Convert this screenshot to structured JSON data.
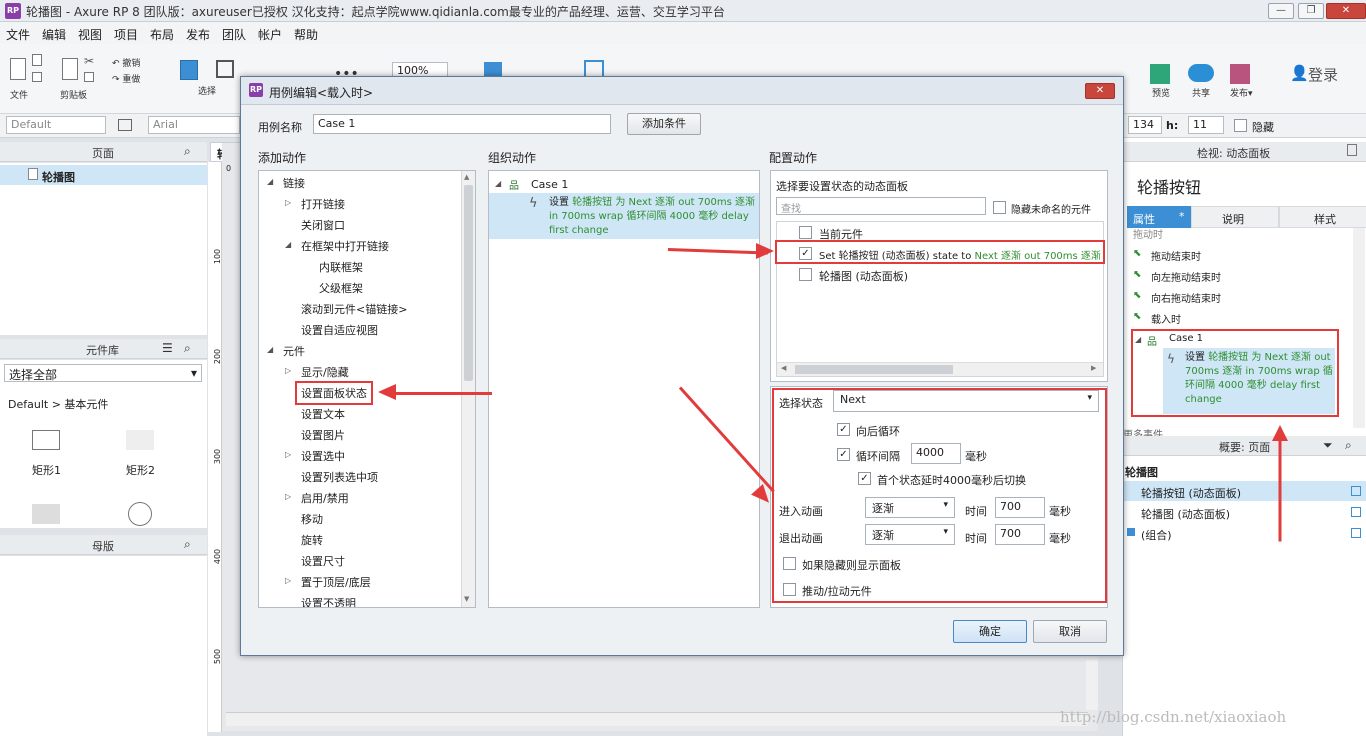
{
  "window": {
    "title": "轮播图 - Axure RP 8 团队版：axureuser已授权 汉化支持：起点学院www.qidianla.com最专业的产品经理、运营、交互学习平台",
    "app_icon": "RP",
    "minimize": "—",
    "restore": "❐",
    "close": "✕"
  },
  "menu": [
    "文件",
    "编辑",
    "视图",
    "项目",
    "布局",
    "发布",
    "团队",
    "帐户",
    "帮助"
  ],
  "toolbar": {
    "file_label": "文件",
    "clipboard_label": "剪贴板",
    "undo_label": "撤销",
    "redo_label": "重做",
    "select_label": "选择",
    "zoom": "100%",
    "preview_label": "预览",
    "share_label": "共享",
    "publish_label": "发布▾",
    "login_label": "登录",
    "style_select": "Default",
    "font_select": "Arial",
    "y_value": "134",
    "h_label": "h:",
    "h_value": "11",
    "hidden_label": "隐藏"
  },
  "pages_panel": {
    "title": "页面",
    "page_name": "轮播图"
  },
  "library_panel": {
    "title": "元件库",
    "select_all": "选择全部",
    "group": "Default > 基本元件",
    "items": [
      "矩形1",
      "矩形2"
    ]
  },
  "masters_panel": {
    "title": "母版"
  },
  "canvas": {
    "tab": "轮播",
    "ruler_top": "0",
    "ruler_left": [
      "100",
      "200",
      "300",
      "400",
      "500"
    ]
  },
  "inspector": {
    "header": "检视: 动态面板",
    "widget_name": "轮播按钮",
    "tabs": [
      "属性",
      "说明",
      "样式"
    ],
    "events": [
      "拖动时",
      "拖动结束时",
      "向左拖动结束时",
      "向右拖动结束时",
      "载入时"
    ],
    "case_name": "Case 1",
    "action_prefix": "设置 ",
    "action_text": "轮播按钮 为 Next 逐渐 out 700ms 逐渐 in 700ms wrap 循环间隔 4000 毫秒 delay first change",
    "more": "更多事件"
  },
  "outline": {
    "header": "概要: 页面",
    "root": "轮播图",
    "items": [
      "轮播按钮 (动态面板)",
      "轮播图 (动态面板)",
      "(组合)"
    ]
  },
  "dialog": {
    "title": "用例编辑<载入时>",
    "case_name_label": "用例名称",
    "case_name_value": "Case 1",
    "add_condition": "添加条件",
    "col1_title": "添加动作",
    "col2_title": "组织动作",
    "col3_title": "配置动作",
    "actions": [
      {
        "label": "链接",
        "level": 0,
        "tri": "◢"
      },
      {
        "label": "打开链接",
        "level": 1,
        "tri": "▷"
      },
      {
        "label": "关闭窗口",
        "level": 1,
        "tri": ""
      },
      {
        "label": "在框架中打开链接",
        "level": 1,
        "tri": "◢"
      },
      {
        "label": "内联框架",
        "level": 2,
        "tri": ""
      },
      {
        "label": "父级框架",
        "level": 2,
        "tri": ""
      },
      {
        "label": "滚动到元件<锚链接>",
        "level": 1,
        "tri": ""
      },
      {
        "label": "设置自适应视图",
        "level": 1,
        "tri": ""
      },
      {
        "label": "元件",
        "level": 0,
        "tri": "◢"
      },
      {
        "label": "显示/隐藏",
        "level": 1,
        "tri": "▷"
      },
      {
        "label": "设置面板状态",
        "level": 1,
        "tri": ""
      },
      {
        "label": "设置文本",
        "level": 1,
        "tri": ""
      },
      {
        "label": "设置图片",
        "level": 1,
        "tri": ""
      },
      {
        "label": "设置选中",
        "level": 1,
        "tri": "▷"
      },
      {
        "label": "设置列表选中项",
        "level": 1,
        "tri": ""
      },
      {
        "label": "启用/禁用",
        "level": 1,
        "tri": "▷"
      },
      {
        "label": "移动",
        "level": 1,
        "tri": ""
      },
      {
        "label": "旋转",
        "level": 1,
        "tri": ""
      },
      {
        "label": "设置尺寸",
        "level": 1,
        "tri": ""
      },
      {
        "label": "置于顶层/底层",
        "level": 1,
        "tri": "▷"
      },
      {
        "label": "设置不透明",
        "level": 1,
        "tri": ""
      }
    ],
    "organize_case": "Case 1",
    "organize_prefix": "设置 ",
    "organize_action": "轮播按钮 为 Next 逐渐 out 700ms 逐渐 in 700ms wrap 循环间隔 4000 毫秒 delay first change",
    "config_prompt": "选择要设置状态的动态面板",
    "search_placeholder": "查找",
    "hide_unnamed": "隐藏未命名的元件",
    "panels": [
      {
        "label": "当前元件",
        "checked": false
      },
      {
        "label": "Set 轮播按钮 (动态面板) state to ",
        "extra": "Next 逐渐 out 700ms 逐渐",
        "checked": true
      },
      {
        "label": "轮播图 (动态面板)",
        "checked": false
      }
    ],
    "state_label": "选择状态",
    "state_value": "Next",
    "wrap_label": "向后循环",
    "repeat_label": "循环间隔",
    "repeat_value": "4000",
    "ms": "毫秒",
    "first_delay_label": "首个状态延时4000毫秒后切换",
    "enter_label": "进入动画",
    "exit_label": "退出动画",
    "anim_value": "逐渐",
    "time_label": "时间",
    "time_value": "700",
    "show_if_hidden": "如果隐藏则显示面板",
    "push_pull": "推动/拉动元件",
    "ok": "确定",
    "cancel": "取消"
  },
  "watermark": "http://blog.csdn.net/xiaoxiaoh",
  "colors": {
    "accent": "#3c8fd4",
    "annotation": "#e23b3b",
    "action_green": "#2f8f2f"
  }
}
